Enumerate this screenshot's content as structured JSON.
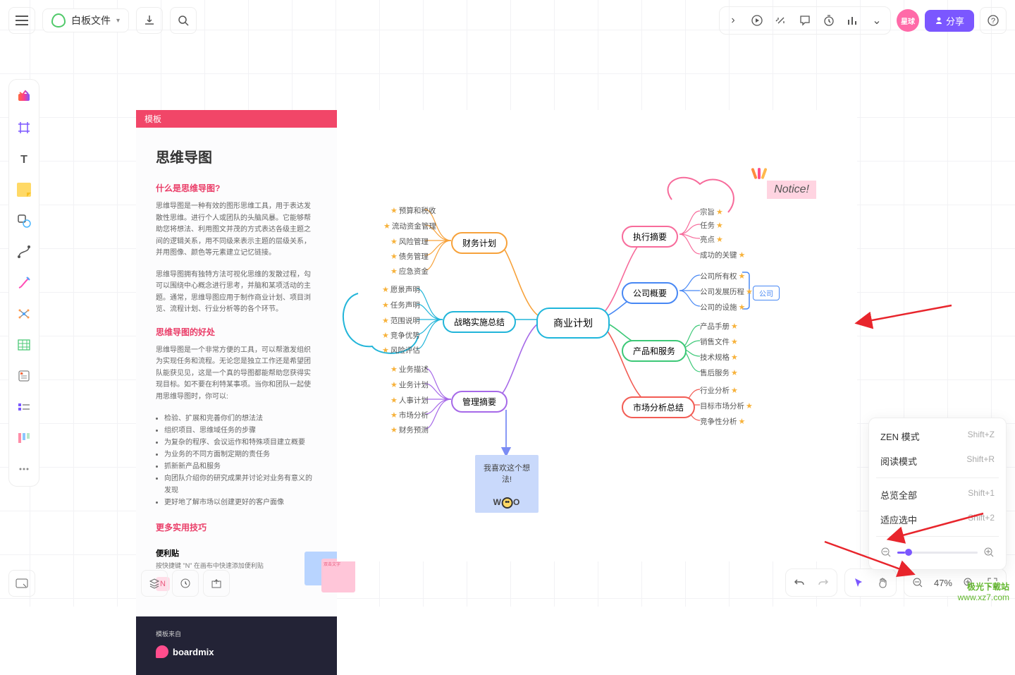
{
  "header": {
    "file_name": "白板文件",
    "share_label": "分享",
    "badge": "星球"
  },
  "template": {
    "banner": "模板",
    "title": "思维导图",
    "sub1": "什么是思维导图?",
    "text1": "思维导图是一种有效的图形思维工具，用于表达发散性思维。进行个人或团队的头脑风暴。它能够帮助您将想法、利用图文并茂的方式表达各级主题之间的逻辑关系，用不同级来表示主题的层级关系，并用图像、颜色等元素建立记忆链接。",
    "text2": "思维导图拥有独特方法可视化思维的发散过程，勾可以围绕中心概念进行思考，并脑和某项活动的主题。通常，思维导图应用于制作商业计划、项目浏览、流程计划、行业分析等的各个环节。",
    "sub2": "思维导图的好处",
    "text3": "思维导图是一个非常方便的工具，可以帮激发组织为实现任务和流程。无论您是独立工作还是希望团队能获见见，这是一个真的导图都能帮助您获得实现目标。如不要在利特某事项。当你和团队一起使用思维导图时，你可以:",
    "bullets": [
      "检验、扩展和完善你们的想法法",
      "组织项目、思维域任务的步骤",
      "为复杂的程序、会议运作和特殊项目建立概要",
      "为业务的不同方面制定期的责任务",
      "抓新新产品和服务",
      "向团队介绍你的研究成果并讨论对业务有意义的发现",
      "更好地了解市场以创建更好的客户面像"
    ],
    "sub3": "更多实用技巧",
    "tip_title": "便利贴",
    "tip_text": "按快捷键 \"N\" 在画布中快速添加便利贴",
    "tip_key": "N",
    "tip_note_text": "双击文字",
    "from": "模板来自",
    "brand": "boardmix"
  },
  "mindmap": {
    "center": "商业计划",
    "branches": {
      "finance": {
        "label": "财务计划",
        "leaves": [
          "预算和税收",
          "流动资金管理",
          "风险管理",
          "债务管理",
          "应急资金"
        ]
      },
      "strategy": {
        "label": "战略实施总结",
        "leaves": [
          "愿景声明",
          "任务声明",
          "范围说明",
          "竞争优势",
          "风险评估"
        ]
      },
      "management": {
        "label": "管理摘要",
        "leaves": [
          "业务描述",
          "业务计划",
          "人事计划",
          "市场分析",
          "财务预测"
        ]
      },
      "exec": {
        "label": "执行摘要",
        "leaves": [
          "宗旨",
          "任务",
          "亮点",
          "成功的关键"
        ]
      },
      "company": {
        "label": "公司概要",
        "leaves": [
          "公司所有权",
          "公司发展历程",
          "公司的设施"
        ],
        "extra": "公司"
      },
      "product": {
        "label": "产品和服务",
        "leaves": [
          "产品手册",
          "销售文件",
          "技术规格",
          "售后服务"
        ]
      },
      "market": {
        "label": "市场分析总结",
        "leaves": [
          "行业分析",
          "目标市场分析",
          "竞争性分析"
        ]
      }
    },
    "notice": "Notice!",
    "sticky": "我喜欢这个想法!",
    "woo": "W",
    "woo2": "O"
  },
  "ctx": {
    "zen": "ZEN 模式",
    "zen_k": "Shift+Z",
    "read": "阅读模式",
    "read_k": "Shift+R",
    "overview": "总览全部",
    "overview_k": "Shift+1",
    "fit": "适应选中",
    "fit_k": "Shift+2"
  },
  "bottom": {
    "zoom": "47%"
  },
  "watermark": {
    "l1": "极光下载站",
    "l2": "www.xz7.com"
  }
}
